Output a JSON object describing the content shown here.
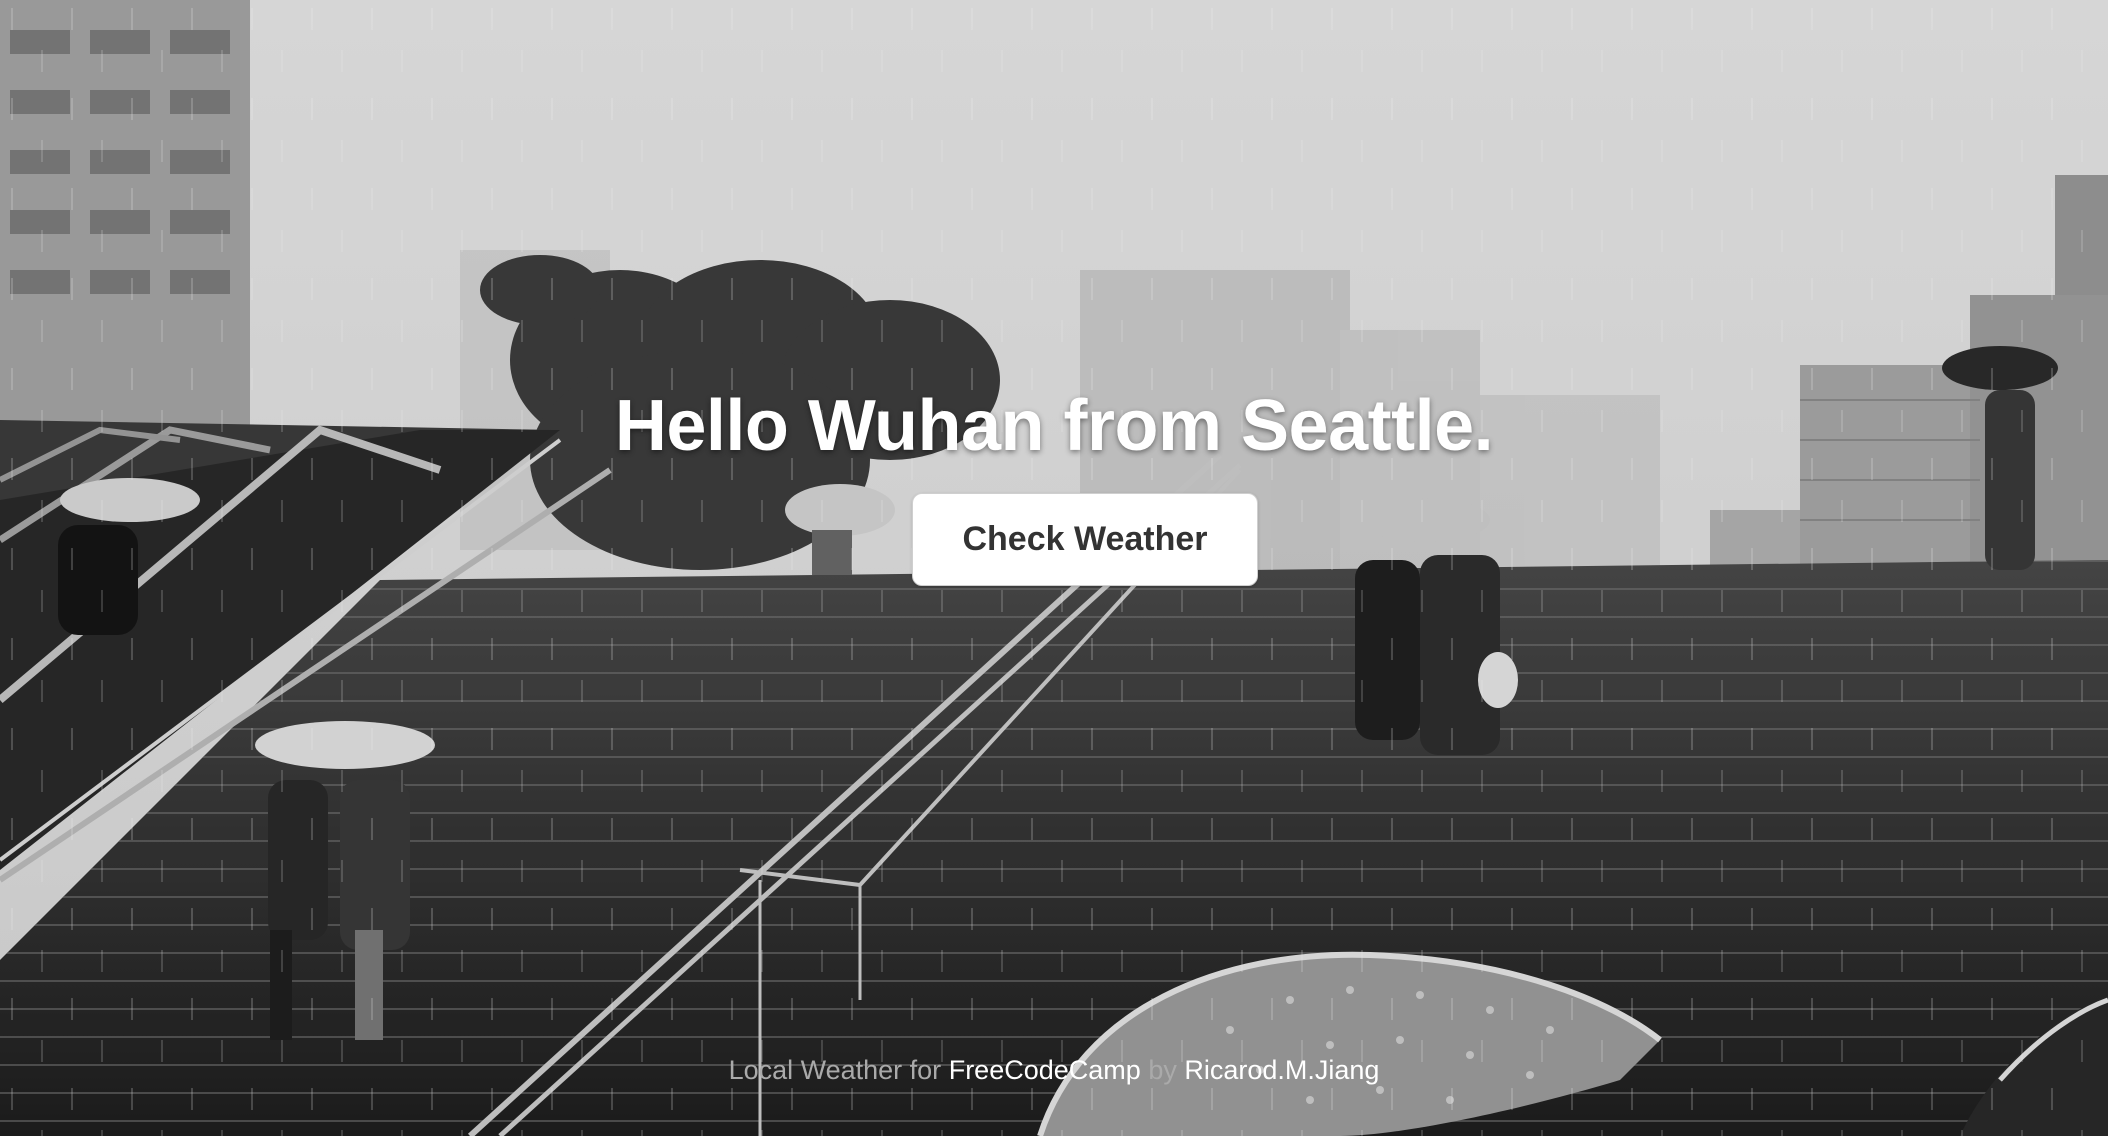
{
  "hero": {
    "headline": "Hello Wuhan from Seattle.",
    "button_label": "Check Weather"
  },
  "footer": {
    "prefix": "Local Weather for",
    "project_link": "FreeCodeCamp",
    "by": "by",
    "author_link": "Ricarod.M.Jiang"
  },
  "colors": {
    "headline": "#ffffff",
    "button_bg": "#ffffff",
    "button_text": "#333333",
    "footer_text": "#aaaaaa",
    "footer_link": "#ffffff"
  }
}
